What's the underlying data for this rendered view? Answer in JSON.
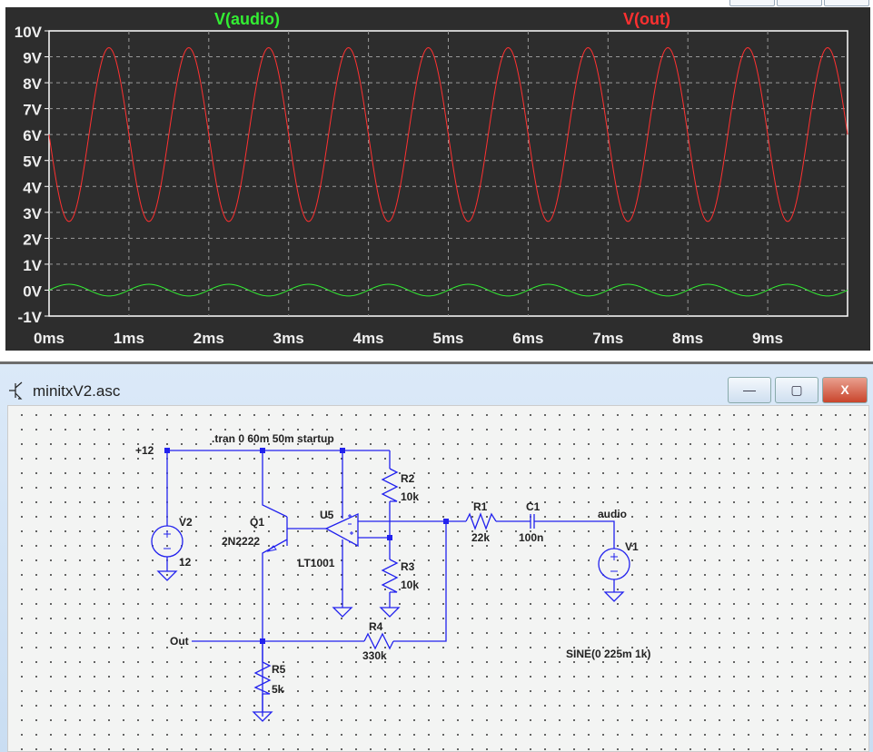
{
  "plot_window": {
    "chart_data": {
      "type": "line",
      "xlabel": "",
      "ylabel": "",
      "xlim": [
        0,
        10
      ],
      "ylim": [
        -1,
        10
      ],
      "x_unit": "ms",
      "x_ticks": [
        "0ms",
        "1ms",
        "2ms",
        "3ms",
        "4ms",
        "5ms",
        "6ms",
        "7ms",
        "8ms",
        "9ms"
      ],
      "y_ticks": [
        "10V",
        "9V",
        "8V",
        "7V",
        "6V",
        "5V",
        "4V",
        "3V",
        "2V",
        "1V",
        "0V",
        "-1V"
      ],
      "grid": true,
      "series": [
        {
          "name": "V(audio)",
          "color": "#33ee33",
          "offset_v": 0,
          "amplitude_v": 0.225,
          "frequency_khz": 1,
          "sign": 1
        },
        {
          "name": "V(out)",
          "color": "#ff3030",
          "offset_v": 6.0,
          "amplitude_v": 3.35,
          "frequency_khz": 1,
          "sign": -1
        }
      ]
    }
  },
  "schematic_window": {
    "title": "minitxV2.asc",
    "buttons": {
      "minimize": "—",
      "maximize": "▢",
      "close": "X"
    },
    "directive": ".tran 0 60m 50m startup",
    "labels": {
      "vcc": "+12",
      "out": "Out",
      "audio": "audio"
    },
    "components": {
      "V2": {
        "name": "V2",
        "value": "12"
      },
      "Q1": {
        "name": "Q1",
        "value": "2N2222"
      },
      "U5": {
        "name": "U5",
        "value": "LT1001"
      },
      "R2": {
        "name": "R2",
        "value": "10k"
      },
      "R3": {
        "name": "R3",
        "value": "10k"
      },
      "R4": {
        "name": "R4",
        "value": "330k"
      },
      "R5": {
        "name": "R5",
        "value": "5k"
      },
      "R1": {
        "name": "R1",
        "value": "22k"
      },
      "C1": {
        "name": "C1",
        "value": "100n"
      },
      "V1": {
        "name": "V1",
        "value": "SINE(0 225m 1k)"
      }
    },
    "wire_color": "#2222ee"
  }
}
